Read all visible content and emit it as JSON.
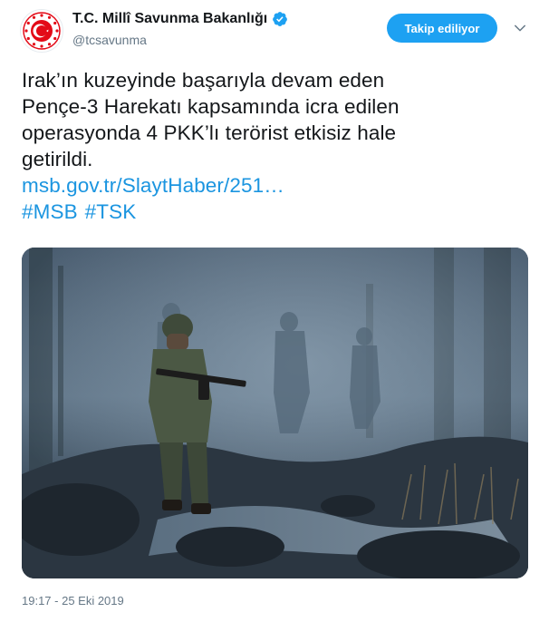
{
  "header": {
    "display_name": "T.C. Millî Savunma Bakanlığı",
    "handle": "@tcsavunma",
    "follow_label": "Takip ediliyor",
    "avatar_icon": "ministry-emblem-icon",
    "verified_icon": "verified-badge-icon",
    "menu_icon": "chevron-down-icon"
  },
  "tweet": {
    "lines": [
      "Irak’ın kuzeyinde başarıyla devam eden",
      "Pençe-3 Harekatı kapsamında icra edilen",
      "operasyonda 4 PKK’lı terörist etkisiz hale",
      "getirildi."
    ],
    "link": "msb.gov.tr/SlaytHaber/251…",
    "hashtags": [
      "#MSB",
      "#TSK"
    ]
  },
  "media": {
    "description_icon": "photo-soldiers-in-fog"
  },
  "footer": {
    "timestamp": "19:17 - 25 Eki 2019"
  },
  "colors": {
    "accent": "#1da1f2",
    "link": "#1b95e0",
    "muted": "#657786",
    "emblem_red": "#e30a17"
  }
}
